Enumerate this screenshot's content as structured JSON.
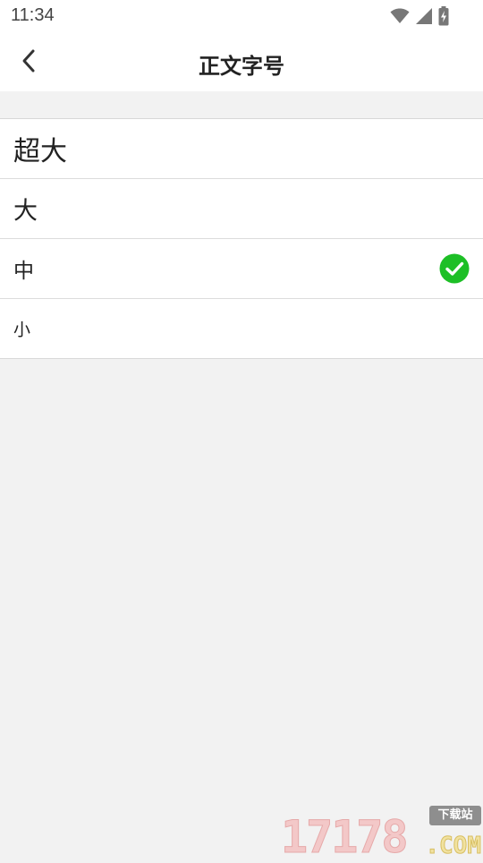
{
  "status_bar": {
    "time": "11:34",
    "icons": [
      "wifi-icon",
      "cell-signal-icon",
      "battery-charging-icon"
    ]
  },
  "nav": {
    "back_icon": "chevron-left-icon",
    "title": "正文字号"
  },
  "options": [
    {
      "label": "超大",
      "selected": false
    },
    {
      "label": "大",
      "selected": false
    },
    {
      "label": "中",
      "selected": true
    },
    {
      "label": "小",
      "selected": false
    }
  ],
  "colors": {
    "accent_check": "#1dbf26",
    "background": "#f2f2f2",
    "surface": "#ffffff",
    "text": "#222222"
  },
  "watermark": {
    "number": "17178",
    "badge": "下载站",
    "suffix": ".COM"
  }
}
